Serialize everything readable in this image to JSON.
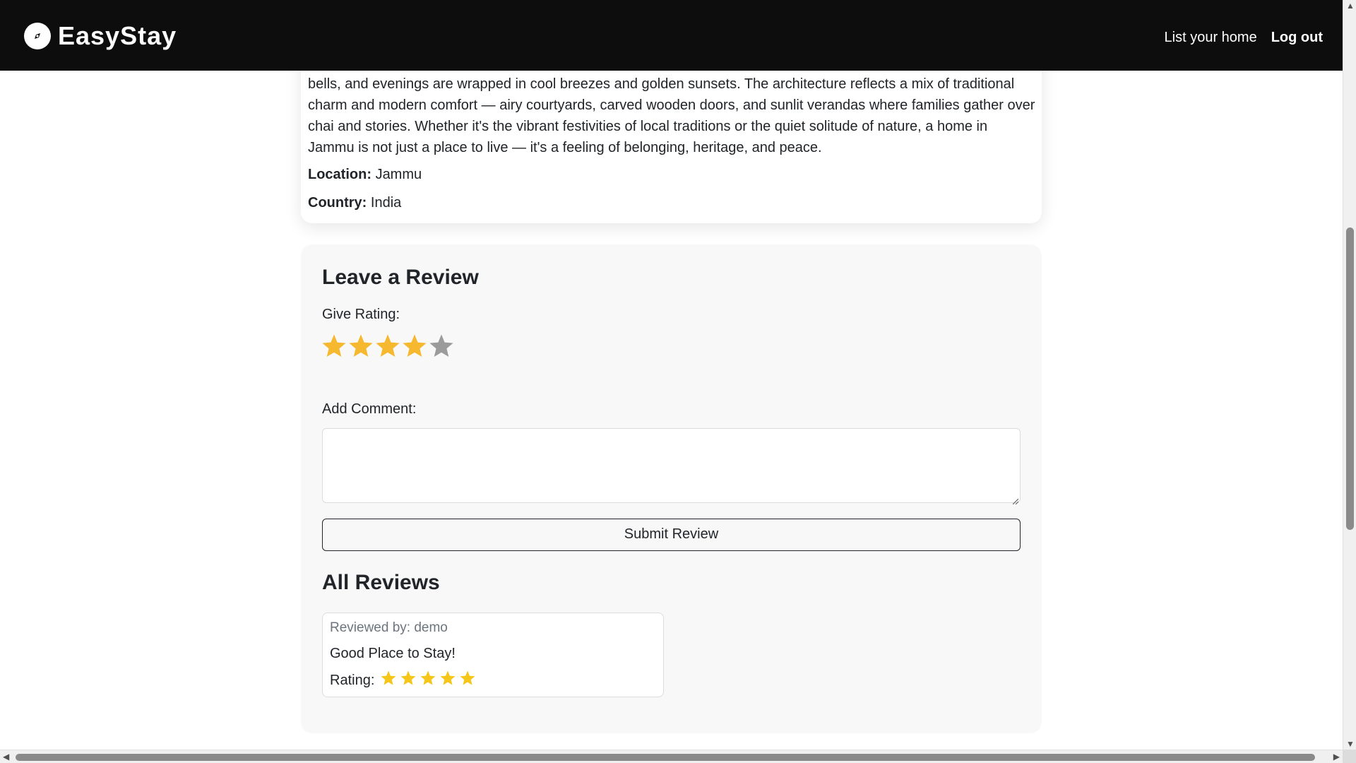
{
  "navbar": {
    "brand": "EasyStay",
    "links": [
      "List your home",
      "Log out"
    ]
  },
  "listing": {
    "description": "bells, and evenings are wrapped in cool breezes and golden sunsets. The architecture reflects a mix of traditional charm and modern comfort — airy courtyards, carved wooden doors, and sunlit verandas where families gather over chai and stories. Whether it's the vibrant festivities of local traditions or the quiet solitude of nature, a home in Jammu is not just a place to live — it's a feeling of belonging, heritage, and peace.",
    "location_label": "Location:",
    "location": "Jammu",
    "country_label": "Country:",
    "country": "India"
  },
  "review_form": {
    "heading": "Leave a Review",
    "rating_label": "Give Rating:",
    "rating_value": 4,
    "rating_max": 5,
    "comment_label": "Add Comment:",
    "comment_value": "",
    "submit_label": "Submit Review"
  },
  "reviews": {
    "heading": "All Reviews",
    "items": [
      {
        "reviewer": "Reviewed by: demo",
        "comment": "Good Place to Stay!",
        "rating_label": "Rating:",
        "rating": 5
      }
    ]
  },
  "colors": {
    "navbar_bg": "#0d0d0d",
    "star_filled": "#f5b82e",
    "star_empty": "#9b9b9b",
    "small_star": "#f5c518"
  },
  "icons": {
    "brand": "compass-icon",
    "rating_star": "star-icon",
    "scroll_arrows": [
      "arrow-up-icon",
      "arrow-down-icon",
      "arrow-left-icon",
      "arrow-right-icon"
    ]
  }
}
